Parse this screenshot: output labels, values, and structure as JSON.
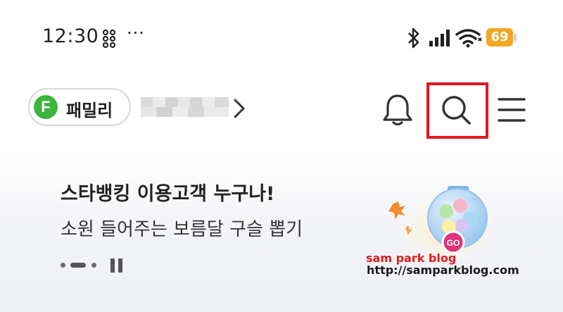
{
  "status_bar": {
    "time": "12:30",
    "more": "···",
    "battery_level": "69",
    "icons": [
      "dice-icon",
      "bluetooth-icon",
      "signal-icon",
      "wifi-icon",
      "battery-icon"
    ],
    "battery_color": "#f5a623"
  },
  "header": {
    "family_badge": "F",
    "family_label": "패밀리",
    "icons": [
      "chevron-right-icon",
      "bell-icon",
      "search-icon",
      "menu-icon"
    ],
    "highlight_color": "#e3161f",
    "badge_color": "#3db53d"
  },
  "banner": {
    "title": "스타뱅킹 이용고객 누구나!",
    "subtitle": "소원 들어주는 보름달 구슬 뽑기",
    "ball_label": "GO"
  },
  "watermark": {
    "line1": "sam park blog",
    "line2": "http://samparkblog.com"
  }
}
